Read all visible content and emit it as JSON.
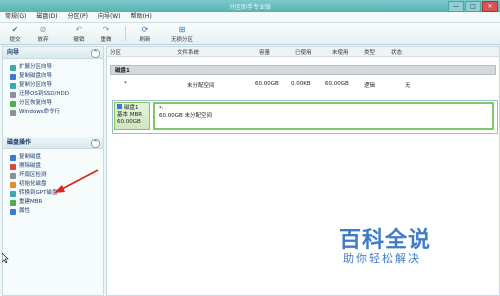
{
  "window": {
    "title": "分区助手专业版",
    "btn_min": "—",
    "btn_max": "□",
    "btn_close": "✕"
  },
  "menu": [
    "常规(G)",
    "磁盘(D)",
    "分区(P)",
    "向导(W)",
    "帮助(H)"
  ],
  "toolbar": {
    "buttons": [
      {
        "label": "提交",
        "icon": "check-icon"
      },
      {
        "label": "放弃",
        "icon": "discard-icon"
      },
      {
        "label": "撤销",
        "icon": "undo-icon"
      },
      {
        "label": "重做",
        "icon": "redo-icon"
      },
      {
        "label": "刷新",
        "icon": "refresh-icon"
      },
      {
        "label": "无损分区",
        "icon": "lossless-partition-icon"
      }
    ]
  },
  "wizard_panel": {
    "title": "向导",
    "collapse": "^",
    "items": [
      "扩展分区向导",
      "复制磁盘向导",
      "复制分区向导",
      "迁移OS到SSD/HDD",
      "分区恢复向导",
      "Windows命令行"
    ]
  },
  "disk_ops_panel": {
    "title": "磁盘操作",
    "collapse": "^",
    "items": [
      "复制磁盘",
      "擦除磁盘",
      "坏扇区检测",
      "初始化磁盘",
      "转换到GPT磁盘",
      "重建MBR",
      "属性"
    ]
  },
  "table": {
    "headers": [
      "分区",
      "文件系统",
      "容量",
      "已使用",
      "未使用",
      "类型",
      "状态"
    ],
    "disk_label": "磁盘1",
    "rows": [
      {
        "partition": "*",
        "fs": "未分配空间",
        "capacity": "60.00GB",
        "used": "0.00KB",
        "free": "60.00GB",
        "type": "逻辑",
        "status": "无"
      }
    ]
  },
  "disk_map": {
    "name": "磁盘1",
    "kind": "基本 MBR",
    "size": "60.00GB",
    "partition_name": "*:",
    "partition_desc": "60.00GB 未分配空间"
  },
  "watermark": {
    "logo": "百科全说",
    "sub": "助你轻松解决"
  }
}
